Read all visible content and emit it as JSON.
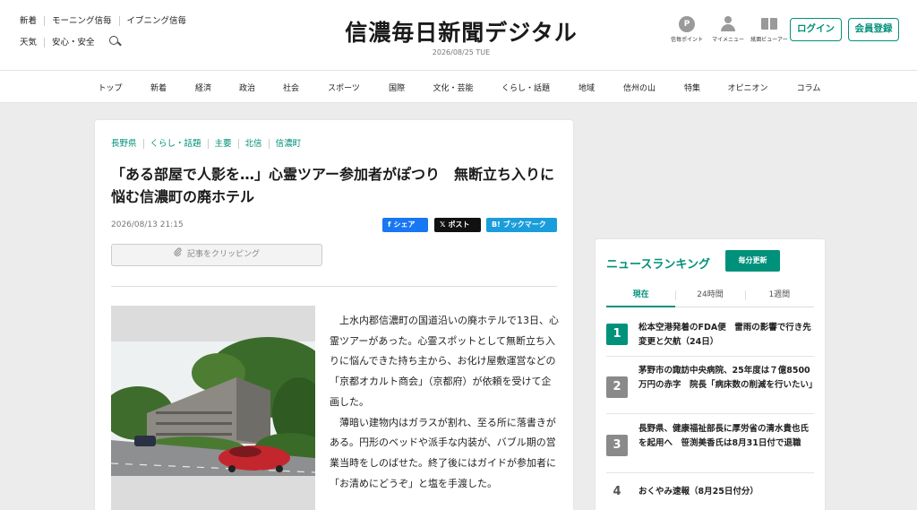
{
  "header": {
    "links_row1": [
      "新着",
      "モーニング信毎",
      "イブニング信毎"
    ],
    "links_row2": [
      "天気",
      "安心・安全"
    ],
    "logo": "信濃毎日新聞デジタル",
    "date": "2026/08/25 TUE",
    "icons": [
      {
        "label": "信毎ポイント",
        "icon": "points-icon",
        "glyph": "P"
      },
      {
        "label": "マイメニュー",
        "icon": "person-icon"
      },
      {
        "label": "紙面ビューアー",
        "icon": "book-icon"
      }
    ],
    "login_label": "ログイン",
    "register_label": "会員登録"
  },
  "nav": [
    "トップ",
    "新着",
    "経済",
    "政治",
    "社会",
    "スポーツ",
    "国際",
    "文化・芸能",
    "くらし・話題",
    "地域",
    "信州の山",
    "特集",
    "オピニオン",
    "コラム"
  ],
  "article": {
    "tags": [
      "長野県",
      "くらし・話題",
      "主要",
      "北信",
      "信濃町"
    ],
    "headline": "「ある部屋で人影を…」心霊ツアー参加者がぽつり　無断立ち入りに悩む信濃町の廃ホテル",
    "date": "2026/08/13 21:15",
    "share": {
      "facebook": "シェア",
      "x": "ポスト",
      "hatena": "ブックマーク",
      "facebook_glyph": "f",
      "x_glyph": "𝕏",
      "hatena_glyph": "B!"
    },
    "clip_label": "記事をクリッピング",
    "paragraphs": [
      "上水内郡信濃町の国道沿いの廃ホテルで13日、心霊ツアーがあった。心霊スポットとして無断立ち入りに悩んできた持ち主から、お化け屋敷運営などの「京都オカルト商会」（京都府）が依頼を受けて企画した。",
      "薄暗い建物内はガラスが割れ、至る所に落書きがある。円形のベッドや派手な内装が、バブル期の営業当時をしのばせた。終了後にはガイドが参加者に「お清めにどうぞ」と塩を手渡した。"
    ]
  },
  "ranking": {
    "title": "ニュースランキング",
    "badge": "毎分更新",
    "tabs": [
      "現在",
      "24時間",
      "1週間"
    ],
    "items": [
      {
        "rank": "1",
        "text": "松本空港発着のFDA便　雷雨の影響で行き先変更と欠航（24日）"
      },
      {
        "rank": "2",
        "text": "茅野市の諏訪中央病院、25年度は７億8500万円の赤字　院長「病床数の削減を行いたい」"
      },
      {
        "rank": "3",
        "text": "長野県、健康福祉部長に厚労省の清水貴也氏を起用へ　笹渕美香氏は8月31日付で退職"
      },
      {
        "rank": "4",
        "text": "おくやみ速報（8月25日付分）"
      }
    ]
  }
}
